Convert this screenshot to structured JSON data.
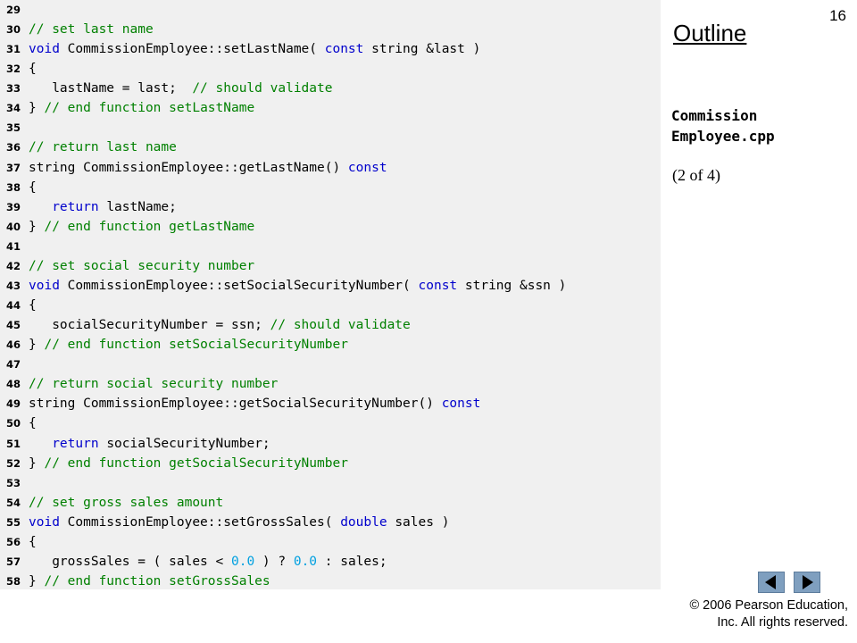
{
  "page_number": "16",
  "outline_title": "Outline",
  "file_name": "Commission\nEmployee.cpp",
  "part_indicator": "(2 of 4)",
  "copyright_line1": "© 2006 Pearson Education,",
  "copyright_line2": "Inc.  All rights reserved.",
  "colors": {
    "keyword": "#0000cc",
    "comment": "#008000",
    "number": "#00a0e0",
    "code_bg": "#f0f0f0",
    "nav_button": "#7f9fbf"
  },
  "icons": {
    "prev": "previous-triangle-icon",
    "next": "next-triangle-icon"
  },
  "code_lines": [
    {
      "num": "29",
      "tokens": []
    },
    {
      "num": "30",
      "tokens": [
        {
          "t": "comment",
          "v": "// set last name"
        }
      ]
    },
    {
      "num": "31",
      "tokens": [
        {
          "t": "keyword",
          "v": "void"
        },
        {
          "t": "plain",
          "v": " CommissionEmployee::setLastName( "
        },
        {
          "t": "keyword",
          "v": "const"
        },
        {
          "t": "plain",
          "v": " string &last )"
        }
      ]
    },
    {
      "num": "32",
      "tokens": [
        {
          "t": "plain",
          "v": "{"
        }
      ]
    },
    {
      "num": "33",
      "tokens": [
        {
          "t": "plain",
          "v": "   lastName = last;  "
        },
        {
          "t": "comment",
          "v": "// should validate"
        }
      ]
    },
    {
      "num": "34",
      "tokens": [
        {
          "t": "plain",
          "v": "} "
        },
        {
          "t": "comment",
          "v": "// end function setLastName"
        }
      ]
    },
    {
      "num": "35",
      "tokens": []
    },
    {
      "num": "36",
      "tokens": [
        {
          "t": "comment",
          "v": "// return last name"
        }
      ]
    },
    {
      "num": "37",
      "tokens": [
        {
          "t": "plain",
          "v": "string CommissionEmployee::getLastName() "
        },
        {
          "t": "keyword",
          "v": "const"
        }
      ]
    },
    {
      "num": "38",
      "tokens": [
        {
          "t": "plain",
          "v": "{"
        }
      ]
    },
    {
      "num": "39",
      "tokens": [
        {
          "t": "plain",
          "v": "   "
        },
        {
          "t": "keyword",
          "v": "return"
        },
        {
          "t": "plain",
          "v": " lastName;"
        }
      ]
    },
    {
      "num": "40",
      "tokens": [
        {
          "t": "plain",
          "v": "} "
        },
        {
          "t": "comment",
          "v": "// end function getLastName"
        }
      ]
    },
    {
      "num": "41",
      "tokens": []
    },
    {
      "num": "42",
      "tokens": [
        {
          "t": "comment",
          "v": "// set social security number"
        }
      ]
    },
    {
      "num": "43",
      "tokens": [
        {
          "t": "keyword",
          "v": "void"
        },
        {
          "t": "plain",
          "v": " CommissionEmployee::setSocialSecurityNumber( "
        },
        {
          "t": "keyword",
          "v": "const"
        },
        {
          "t": "plain",
          "v": " string &ssn )"
        }
      ]
    },
    {
      "num": "44",
      "tokens": [
        {
          "t": "plain",
          "v": "{"
        }
      ]
    },
    {
      "num": "45",
      "tokens": [
        {
          "t": "plain",
          "v": "   socialSecurityNumber = ssn; "
        },
        {
          "t": "comment",
          "v": "// should validate"
        }
      ]
    },
    {
      "num": "46",
      "tokens": [
        {
          "t": "plain",
          "v": "} "
        },
        {
          "t": "comment",
          "v": "// end function setSocialSecurityNumber"
        }
      ]
    },
    {
      "num": "47",
      "tokens": []
    },
    {
      "num": "48",
      "tokens": [
        {
          "t": "comment",
          "v": "// return social security number"
        }
      ]
    },
    {
      "num": "49",
      "tokens": [
        {
          "t": "plain",
          "v": "string CommissionEmployee::getSocialSecurityNumber() "
        },
        {
          "t": "keyword",
          "v": "const"
        }
      ]
    },
    {
      "num": "50",
      "tokens": [
        {
          "t": "plain",
          "v": "{"
        }
      ]
    },
    {
      "num": "51",
      "tokens": [
        {
          "t": "plain",
          "v": "   "
        },
        {
          "t": "keyword",
          "v": "return"
        },
        {
          "t": "plain",
          "v": " socialSecurityNumber;"
        }
      ]
    },
    {
      "num": "52",
      "tokens": [
        {
          "t": "plain",
          "v": "} "
        },
        {
          "t": "comment",
          "v": "// end function getSocialSecurityNumber"
        }
      ]
    },
    {
      "num": "53",
      "tokens": []
    },
    {
      "num": "54",
      "tokens": [
        {
          "t": "comment",
          "v": "// set gross sales amount"
        }
      ]
    },
    {
      "num": "55",
      "tokens": [
        {
          "t": "keyword",
          "v": "void"
        },
        {
          "t": "plain",
          "v": " CommissionEmployee::setGrossSales( "
        },
        {
          "t": "keyword",
          "v": "double"
        },
        {
          "t": "plain",
          "v": " sales )"
        }
      ]
    },
    {
      "num": "56",
      "tokens": [
        {
          "t": "plain",
          "v": "{"
        }
      ]
    },
    {
      "num": "57",
      "tokens": [
        {
          "t": "plain",
          "v": "   grossSales = ( sales < "
        },
        {
          "t": "number",
          "v": "0.0"
        },
        {
          "t": "plain",
          "v": " ) ? "
        },
        {
          "t": "number",
          "v": "0.0"
        },
        {
          "t": "plain",
          "v": " : sales;"
        }
      ]
    },
    {
      "num": "58",
      "tokens": [
        {
          "t": "plain",
          "v": "} "
        },
        {
          "t": "comment",
          "v": "// end function setGrossSales"
        }
      ]
    }
  ]
}
